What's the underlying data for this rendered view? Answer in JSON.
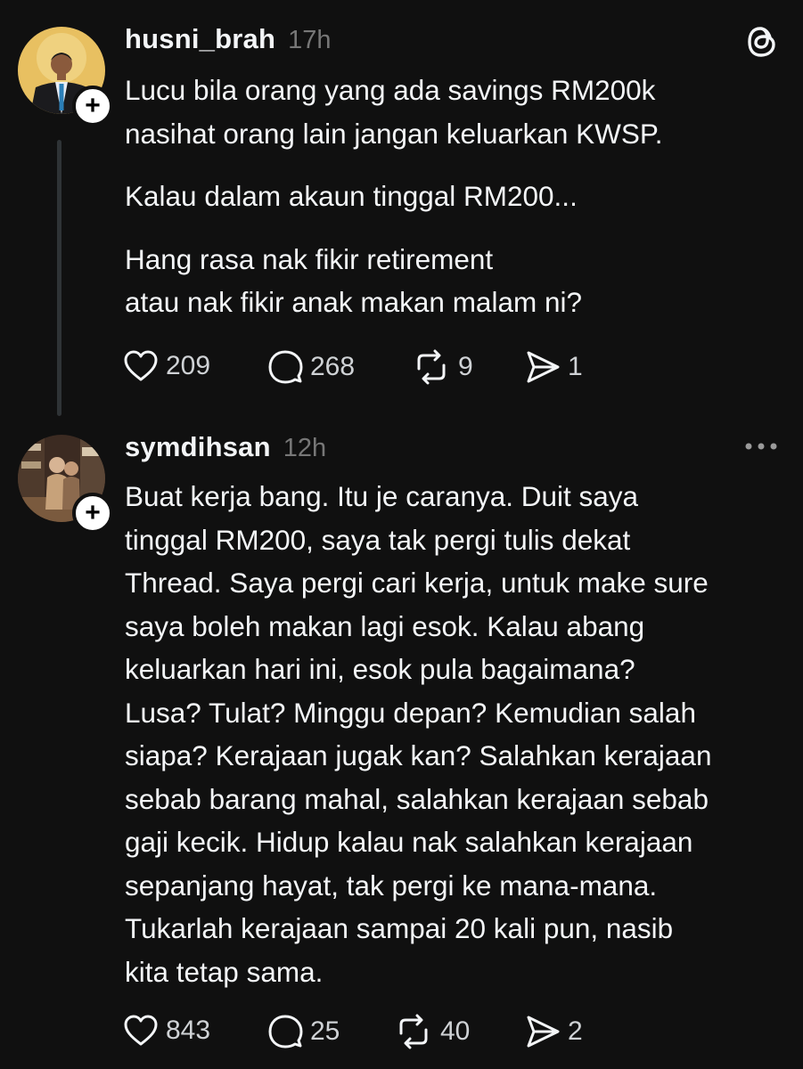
{
  "posts": [
    {
      "username": "husni_brah",
      "time": "17h",
      "paragraphs": [
        "Lucu bila orang yang ada savings RM200k",
        "nasihat orang lain jangan keluarkan KWSP.",
        "Kalau dalam akaun tinggal RM200...",
        "Hang rasa nak fikir retirement",
        "atau nak fikir anak makan malam ni?"
      ],
      "stats": {
        "likes": "209",
        "replies": "268",
        "reposts": "9",
        "shares": "1"
      },
      "corner_icon": "threads-logo-icon"
    },
    {
      "username": "symdihsan",
      "time": "12h",
      "lines": [
        "Buat kerja bang. Itu je caranya. Duit saya",
        "tinggal RM200, saya tak pergi tulis dekat",
        "Thread. Saya pergi cari kerja, untuk make sure",
        "saya boleh makan lagi esok. Kalau abang",
        "keluarkan hari ini, esok pula bagaimana?",
        "Lusa? Tulat? Minggu depan? Kemudian salah",
        "siapa? Kerajaan jugak kan? Salahkan kerajaan",
        "sebab barang mahal, salahkan kerajaan sebab",
        "gaji kecik. Hidup kalau nak salahkan kerajaan",
        "sepanjang hayat, tak pergi ke mana-mana.",
        "Tukarlah kerajaan sampai 20 kali pun, nasib",
        "kita tetap sama."
      ],
      "stats": {
        "likes": "843",
        "replies": "25",
        "reposts": "40",
        "shares": "2"
      },
      "corner_icon": "more-options-icon"
    }
  ],
  "colors": {
    "background": "#101010",
    "text": "#f3f5f7",
    "muted": "#777777",
    "thread_line": "#2f3336"
  }
}
